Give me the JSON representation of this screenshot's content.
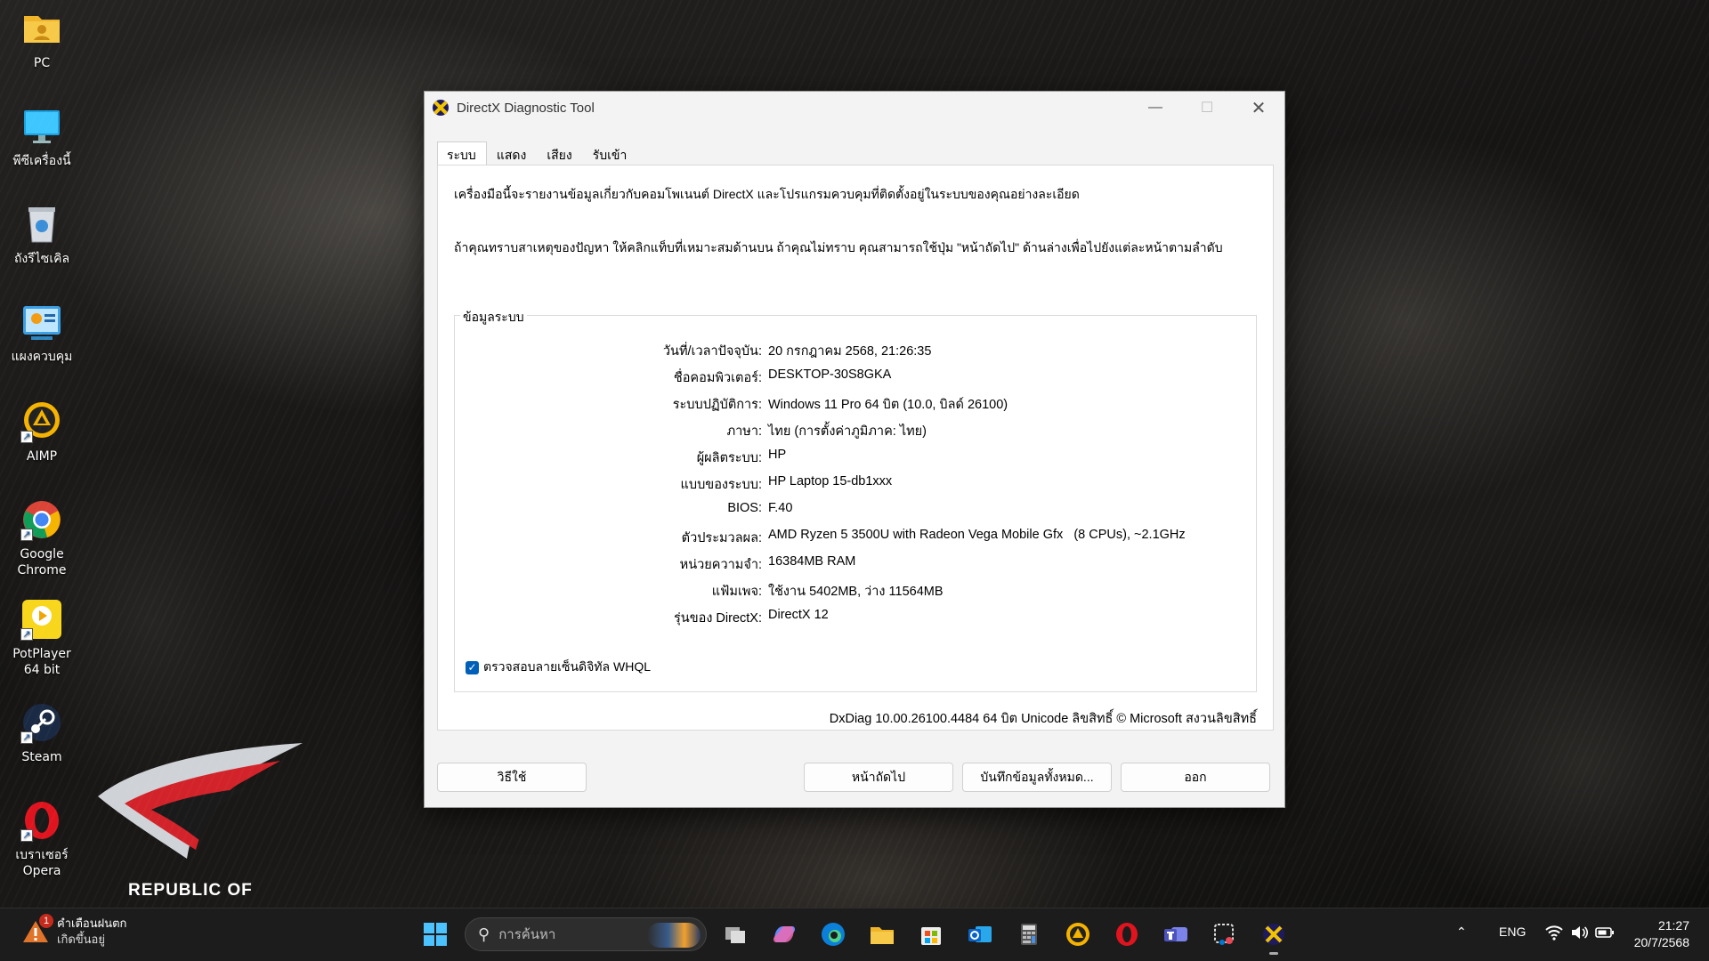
{
  "desktop": {
    "icons": [
      {
        "label": "PC"
      },
      {
        "label": "พีซีเครื่องนี้"
      },
      {
        "label": "ถังรีไซเคิล"
      },
      {
        "label": "แผงควบคุม"
      },
      {
        "label": "AIMP"
      },
      {
        "label": "Google Chrome"
      },
      {
        "label": "PotPlayer 64 bit"
      },
      {
        "label": "Steam"
      },
      {
        "label": "เบราเซอร์ Opera"
      }
    ],
    "wallpaper_text": "REPUBLIC OF"
  },
  "window": {
    "title": "DirectX Diagnostic Tool",
    "tabs": [
      "ระบบ",
      "แสดง",
      "เสียง",
      "รับเข้า"
    ],
    "active_tab": "ระบบ",
    "intro1": "เครื่องมือนี้จะรายงานข้อมูลเกี่ยวกับคอมโพเนนต์ DirectX และโปรแกรมควบคุมที่ติดตั้งอยู่ในระบบของคุณอย่างละเอียด",
    "intro2": "ถ้าคุณทราบสาเหตุของปัญหา ให้คลิกแท็บที่เหมาะสมด้านบน ถ้าคุณไม่ทราบ คุณสามารถใช้ปุ่ม \"หน้าถัดไป\" ด้านล่างเพื่อไปยังแต่ละหน้าตามลำดับ",
    "group_title": "ข้อมูลระบบ",
    "info": [
      {
        "label": "วันที่/เวลาปัจจุบัน:",
        "value": "20 กรกฎาคม 2568, 21:26:35"
      },
      {
        "label": "ชื่อคอมพิวเตอร์:",
        "value": "DESKTOP-30S8GKA"
      },
      {
        "label": "ระบบปฏิบัติการ:",
        "value": "Windows 11 Pro 64 บิต (10.0, บิลด์ 26100)"
      },
      {
        "label": "ภาษา:",
        "value": "ไทย (การตั้งค่าภูมิภาค: ไทย)"
      },
      {
        "label": "ผู้ผลิตระบบ:",
        "value": "HP"
      },
      {
        "label": "แบบของระบบ:",
        "value": "HP Laptop 15-db1xxx"
      },
      {
        "label": "BIOS:",
        "value": "F.40"
      },
      {
        "label": "ตัวประมวลผล:",
        "value": "AMD Ryzen 5 3500U with Radeon Vega Mobile Gfx   (8 CPUs), ~2.1GHz"
      },
      {
        "label": "หน่วยความจำ:",
        "value": "16384MB RAM"
      },
      {
        "label": "แฟ้มเพจ:",
        "value": "ใช้งาน 5402MB, ว่าง 11564MB"
      },
      {
        "label": "รุ่นของ DirectX:",
        "value": "DirectX 12"
      }
    ],
    "whql_label": "ตรวจสอบลายเซ็นดิจิทัล WHQL",
    "whql_checked": true,
    "footer": "DxDiag 10.00.26100.4484 64 บิต Unicode  ลิขสิทธิ์ © Microsoft สงวนลิขสิทธิ์",
    "buttons": {
      "help": "วิธีใช้",
      "next": "หน้าถัดไป",
      "save": "บันทึกข้อมูลทั้งหมด...",
      "exit": "ออก"
    }
  },
  "taskbar": {
    "weather_line1": "คำเตือนฝนตก",
    "weather_line2": "เกิดขึ้นอยู่",
    "weather_badge": "1",
    "search_placeholder": "การค้นหา",
    "language": "ENG",
    "time": "21:27",
    "date": "20/7/2568"
  }
}
